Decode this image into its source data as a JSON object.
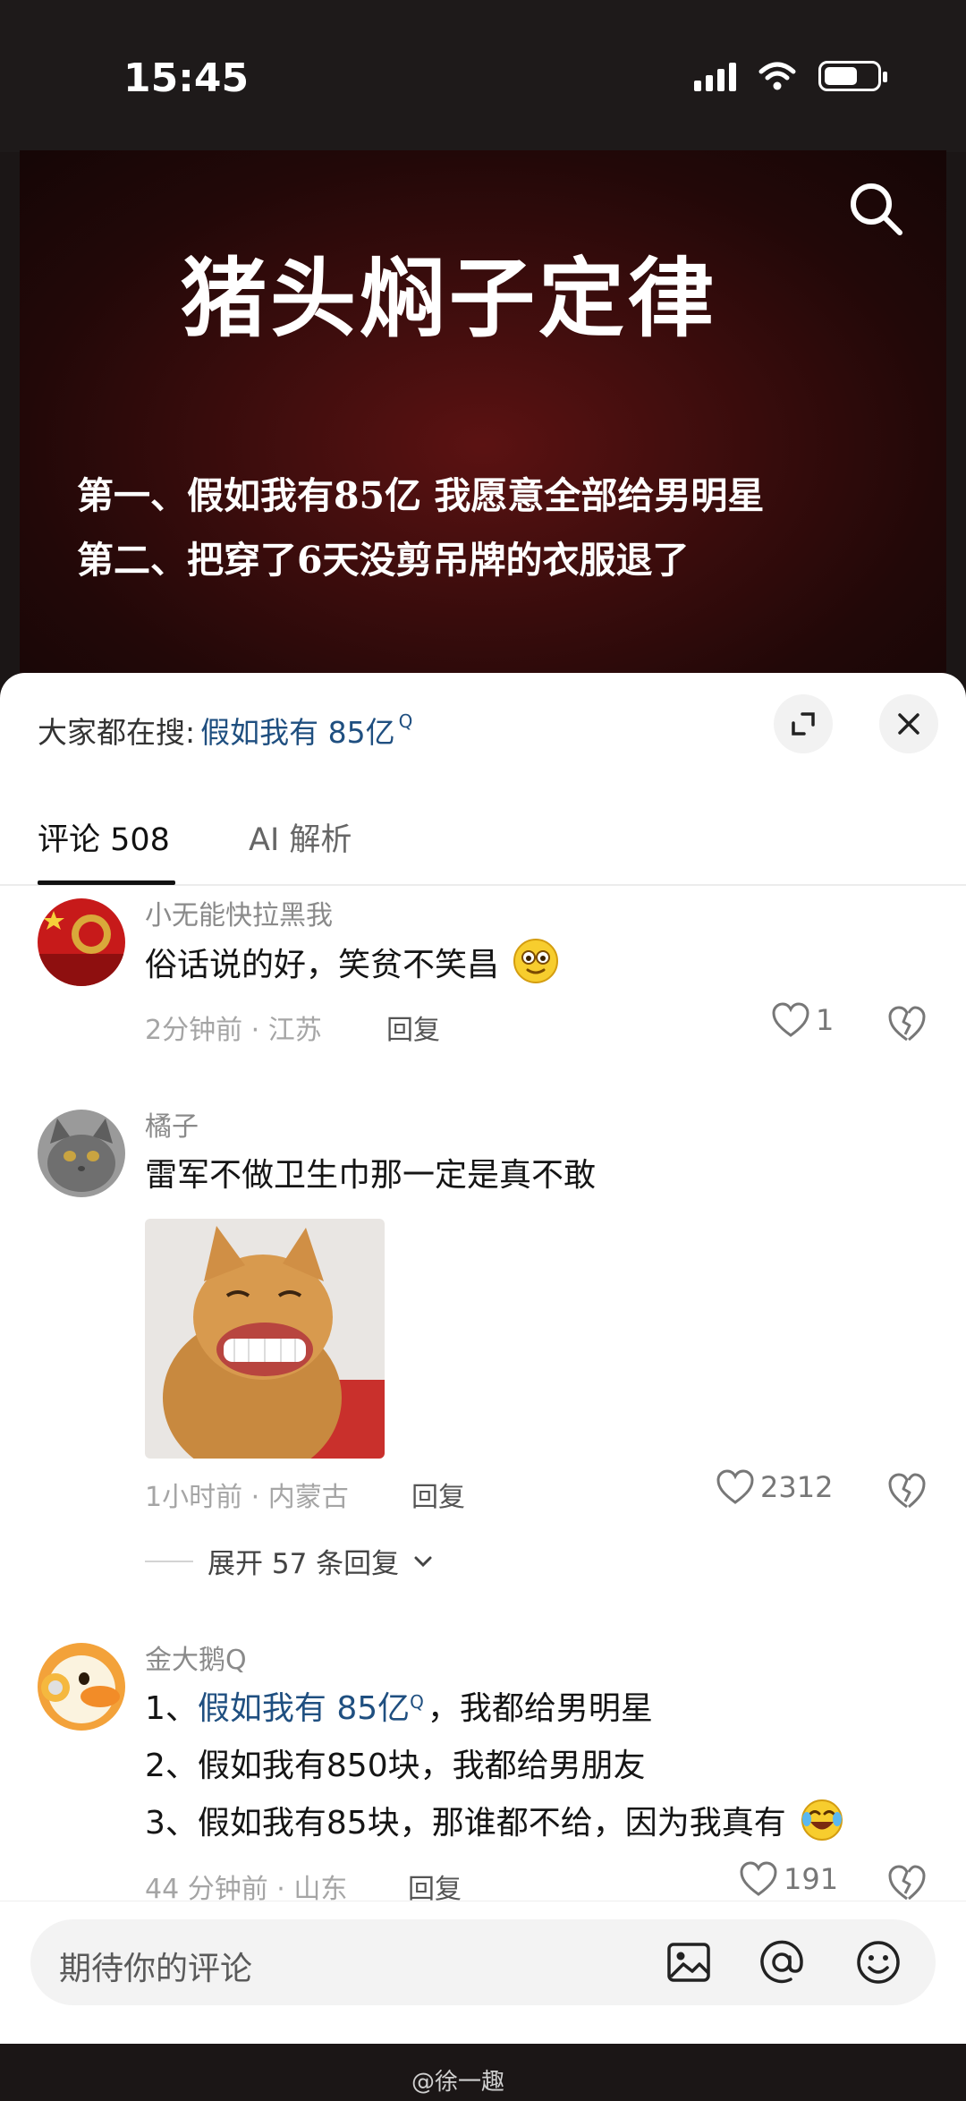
{
  "status_bar": {
    "time": "15:45"
  },
  "video": {
    "title": "猪头焖子定律",
    "line1": "第一、假如我有85亿 我愿意全部给男明星",
    "line2": "第二、把穿了6天没剪吊牌的衣服退了"
  },
  "hot_search": {
    "prefix": "大家都在搜:",
    "keyword": "假如我有 85亿"
  },
  "tabs": {
    "comments": "评论 508",
    "ai": "AI 解析"
  },
  "comments": [
    {
      "user": "小无能快拉黑我",
      "text": "俗话说的好，笑贫不笑昌",
      "time": "2分钟前 · 江苏",
      "reply": "回复",
      "likes": "1"
    },
    {
      "user": "橘子",
      "text": "雷军不做卫生巾那一定是真不敢",
      "time": "1小时前 · 内蒙古",
      "reply": "回复",
      "likes": "2312",
      "expand": "展开 57 条回复"
    },
    {
      "user": "金大鹅Q",
      "line1_prefix": "1、",
      "line1_kw": "假如我有 85亿",
      "line1_rest": "，我都给男明星",
      "line2": "2、假如我有850块，我都给男朋友",
      "line3": "3、假如我有85块，那谁都不给，因为我真有",
      "time": "44 分钟前 · 山东",
      "reply": "回复",
      "likes": "191"
    }
  ],
  "input": {
    "placeholder": "期待你的评论"
  },
  "watermark": "@徐一趣",
  "colors": {
    "keyword": "#1f4f80",
    "video_bg": "#3e0d0d"
  }
}
